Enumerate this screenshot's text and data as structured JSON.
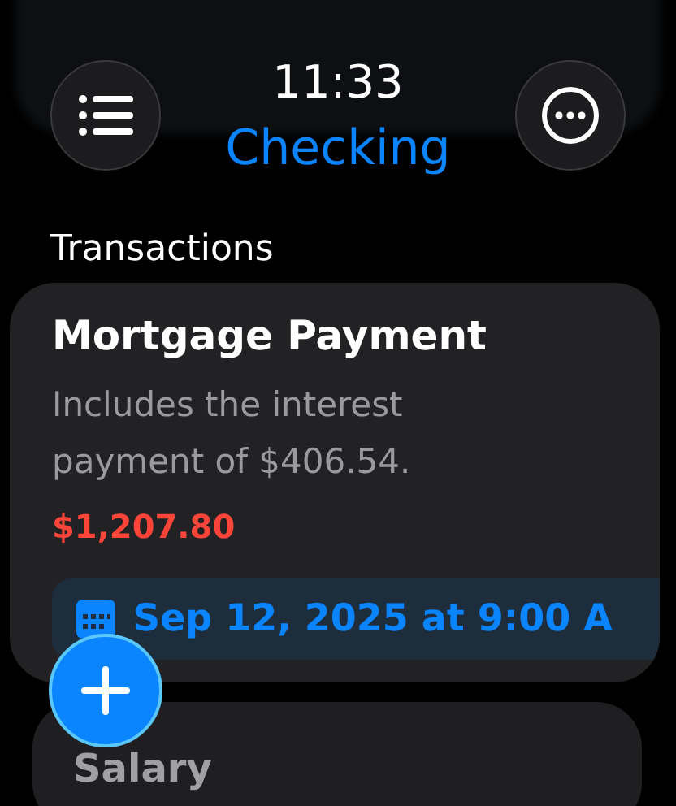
{
  "time": "11:33",
  "title": "Checking",
  "section": "Transactions",
  "transactions": [
    {
      "title": "Mortgage Payment",
      "note": "Includes the interest payment of $406.54.",
      "amount": "$1,207.80",
      "date": "Sep 12, 2025 at 9:00 A"
    },
    {
      "title": "Salary"
    }
  ]
}
